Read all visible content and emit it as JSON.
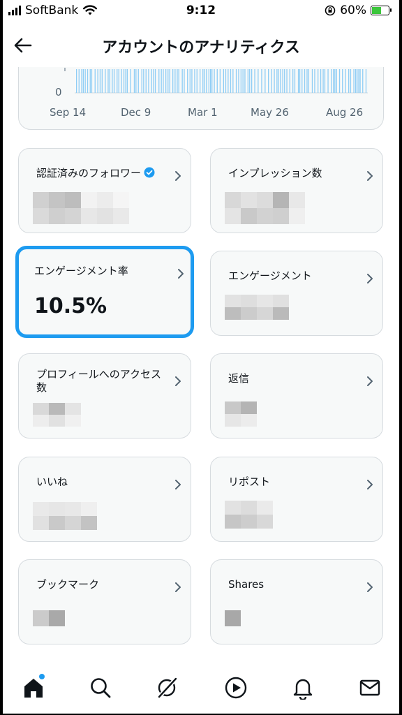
{
  "status_bar": {
    "carrier": "SoftBank",
    "time": "9:12",
    "battery": "60%",
    "battery_level": 0.6
  },
  "header": {
    "title": "アカウントのアナリティクス",
    "back_icon": "arrow-left-icon"
  },
  "chart": {
    "y_axis_zero": "0",
    "x_labels": [
      "Sep 14",
      "Dec 9",
      "Mar 1",
      "May 26",
      "Aug 26"
    ],
    "bar_color": "#8ecdf5"
  },
  "metrics": [
    {
      "label": "認証済みのフォロワー",
      "verified_badge": true,
      "value": ""
    },
    {
      "label": "インプレッション数",
      "value": ""
    },
    {
      "label": "エンゲージメント率",
      "value": "10.5%",
      "selected": true
    },
    {
      "label": "エンゲージメント",
      "value": ""
    },
    {
      "label": "プロフィールへのアクセス数",
      "value": ""
    },
    {
      "label": "返信",
      "value": ""
    },
    {
      "label": "いいね",
      "value": ""
    },
    {
      "label": "リポスト",
      "value": ""
    },
    {
      "label": "ブックマーク",
      "value": ""
    },
    {
      "label": "Shares",
      "value": ""
    }
  ],
  "bottom_nav": [
    {
      "icon": "home-icon",
      "notification_dot": true
    },
    {
      "icon": "search-icon"
    },
    {
      "icon": "grok-icon"
    },
    {
      "icon": "video-play-icon"
    },
    {
      "icon": "bell-icon"
    },
    {
      "icon": "mail-icon"
    }
  ],
  "colors": {
    "accent": "#1d9bf0",
    "text": "#0f1419",
    "secondary_text": "#536471",
    "card_background": "#f7f9f9",
    "card_border": "#d6dbdf"
  }
}
